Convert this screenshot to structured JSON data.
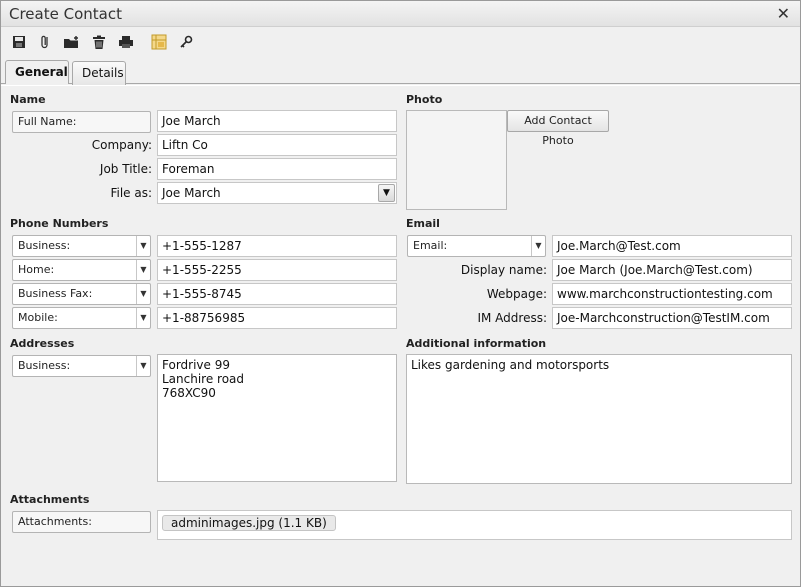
{
  "window": {
    "title": "Create Contact"
  },
  "toolbar": {
    "icons": [
      "save-icon",
      "paperclip-icon",
      "add-folder-icon",
      "trash-icon",
      "print-icon",
      "address-book-icon",
      "key-icon"
    ]
  },
  "tabs": [
    {
      "label": "General",
      "active": true
    },
    {
      "label": "Details",
      "active": false
    }
  ],
  "name": {
    "section": "Name",
    "full_name_label": "Full Name:",
    "full_name": "Joe March",
    "company_label": "Company:",
    "company": "Liftn Co",
    "job_title_label": "Job Title:",
    "job_title": "Foreman",
    "file_as_label": "File as:",
    "file_as": "Joe March"
  },
  "photo": {
    "section": "Photo",
    "add_button": "Add Contact Photo"
  },
  "phones": {
    "section": "Phone Numbers",
    "rows": [
      {
        "type": "Business:",
        "value": "+1-555-1287"
      },
      {
        "type": "Home:",
        "value": "+1-555-2255"
      },
      {
        "type": "Business Fax:",
        "value": "+1-555-8745"
      },
      {
        "type": "Mobile:",
        "value": "+1-88756985"
      }
    ]
  },
  "email": {
    "section": "Email",
    "type": "Email:",
    "address": "Joe.March@Test.com",
    "display_name_label": "Display name:",
    "display_name": "Joe March (Joe.March@Test.com)",
    "webpage_label": "Webpage:",
    "webpage": "www.marchconstructiontesting.com",
    "im_label": "IM Address:",
    "im": "Joe-Marchconstruction@TestIM.com"
  },
  "addresses": {
    "section": "Addresses",
    "type": "Business:",
    "lines": [
      "Fordrive 99",
      "Lanchire road",
      "768XC90"
    ]
  },
  "additional": {
    "section": "Additional information",
    "text": "Likes gardening and motorsports"
  },
  "attachments": {
    "section": "Attachments",
    "label": "Attachments:",
    "file": "adminimages.jpg (1.1 KB)"
  },
  "colors": {
    "window_bg": "#f0f0f0",
    "field_border": "#c7c7c7"
  }
}
